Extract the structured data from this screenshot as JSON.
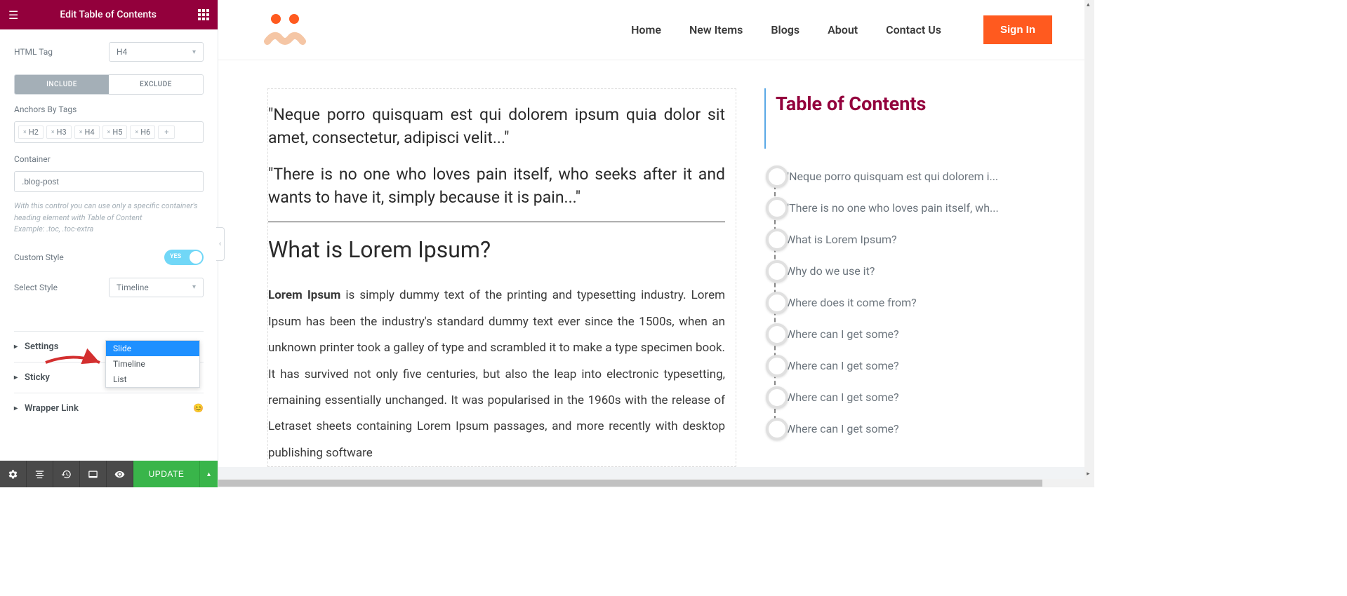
{
  "sidebar": {
    "title": "Edit Table of Contents",
    "html_tag_label": "HTML Tag",
    "html_tag_value": "H4",
    "tabs": {
      "include": "INCLUDE",
      "exclude": "EXCLUDE"
    },
    "anchors_label": "Anchors By Tags",
    "anchor_tags": [
      "H2",
      "H3",
      "H4",
      "H5",
      "H6"
    ],
    "container_label": "Container",
    "container_value": ".blog-post",
    "help_line1": "With this control you can use only a specific container's heading element with Table of Content",
    "help_line2": "Example: .toc, .toc-extra",
    "custom_style_label": "Custom Style",
    "toggle_yes": "YES",
    "select_style_label": "Select Style",
    "select_style_value": "Timeline",
    "style_options": [
      "Slide",
      "Timeline",
      "List"
    ],
    "accordion": {
      "settings": "Settings",
      "sticky": "Sticky",
      "wrapper": "Wrapper Link"
    },
    "update_btn": "UPDATE"
  },
  "preview": {
    "nav": [
      "Home",
      "New Items",
      "Blogs",
      "About",
      "Contact Us"
    ],
    "sign_in": "Sign In",
    "quote1": "\"Neque porro quisquam est qui dolorem ipsum quia dolor sit amet, consectetur, adipisci velit...\"",
    "quote2": "\"There is no one who loves pain itself, who seeks after it and wants to have it, simply because it is pain...\"",
    "h2": "What is Lorem Ipsum?",
    "para_strong": "Lorem Ipsum",
    "para_rest": " is simply dummy text of the printing and typesetting industry. Lorem Ipsum has been the industry's standard dummy text ever since the 1500s, when an unknown printer took a galley of type and scrambled it to make a type specimen book. It has survived not only five centuries, but also the leap into electronic typesetting, remaining essentially unchanged. It was popularised in the 1960s with the release of Letraset sheets containing Lorem Ipsum passages, and more recently with desktop publishing software",
    "toc_title": "Table of Contents",
    "toc_items": [
      "\"Neque porro quisquam est qui dolorem i...",
      "\"There is no one who loves pain itself, wh...",
      "What is Lorem Ipsum?",
      "Why do we use it?",
      "Where does it come from?",
      "Where can I get some?",
      "Where can I get some?",
      "Where can I get some?",
      "Where can I get some?"
    ]
  }
}
